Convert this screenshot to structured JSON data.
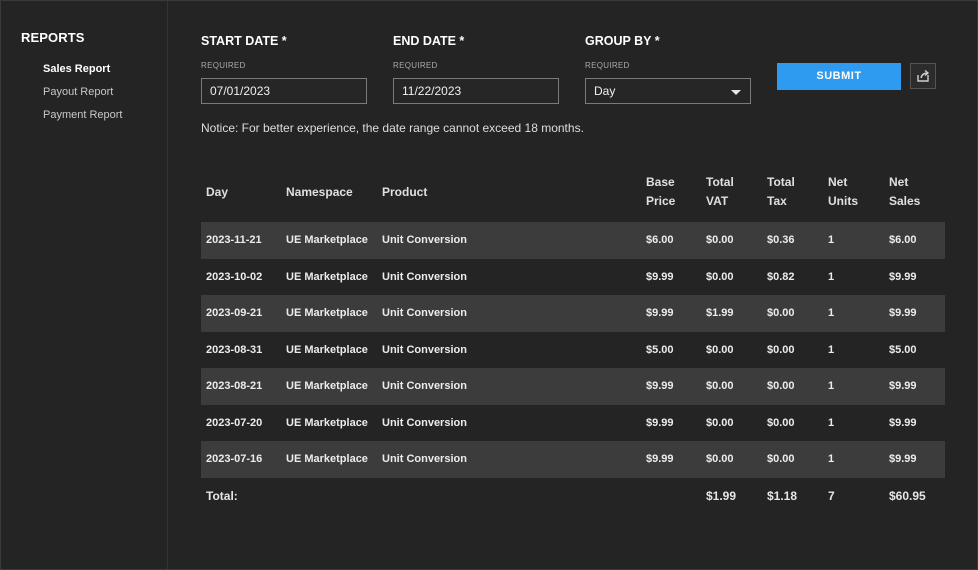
{
  "sidebar": {
    "title": "REPORTS",
    "items": [
      {
        "label": "Sales Report",
        "active": true
      },
      {
        "label": "Payout Report",
        "active": false
      },
      {
        "label": "Payment Report",
        "active": false
      }
    ]
  },
  "filters": {
    "start_date": {
      "label": "START DATE *",
      "sub": "REQUIRED",
      "value": "07/01/2023"
    },
    "end_date": {
      "label": "END DATE *",
      "sub": "REQUIRED",
      "value": "11/22/2023"
    },
    "group_by": {
      "label": "GROUP BY *",
      "sub": "REQUIRED",
      "value": "Day"
    },
    "submit_label": "SUBMIT",
    "export_icon": "share-export-icon"
  },
  "notice": "Notice: For better experience, the date range cannot exceed 18 months.",
  "table": {
    "headers": {
      "day": "Day",
      "namespace": "Namespace",
      "product": "Product",
      "base_price_1": "Base",
      "base_price_2": "Price",
      "total_vat_1": "Total",
      "total_vat_2": "VAT",
      "total_tax_1": "Total",
      "total_tax_2": "Tax",
      "net_units_1": "Net",
      "net_units_2": "Units",
      "net_sales_1": "Net",
      "net_sales_2": "Sales"
    },
    "rows": [
      {
        "day": "2023-11-21",
        "namespace": "UE Marketplace",
        "product": "Unit Conversion",
        "base_price": "$6.00",
        "total_vat": "$0.00",
        "total_tax": "$0.36",
        "net_units": "1",
        "net_sales": "$6.00"
      },
      {
        "day": "2023-10-02",
        "namespace": "UE Marketplace",
        "product": "Unit Conversion",
        "base_price": "$9.99",
        "total_vat": "$0.00",
        "total_tax": "$0.82",
        "net_units": "1",
        "net_sales": "$9.99"
      },
      {
        "day": "2023-09-21",
        "namespace": "UE Marketplace",
        "product": "Unit Conversion",
        "base_price": "$9.99",
        "total_vat": "$1.99",
        "total_tax": "$0.00",
        "net_units": "1",
        "net_sales": "$9.99"
      },
      {
        "day": "2023-08-31",
        "namespace": "UE Marketplace",
        "product": "Unit Conversion",
        "base_price": "$5.00",
        "total_vat": "$0.00",
        "total_tax": "$0.00",
        "net_units": "1",
        "net_sales": "$5.00"
      },
      {
        "day": "2023-08-21",
        "namespace": "UE Marketplace",
        "product": "Unit Conversion",
        "base_price": "$9.99",
        "total_vat": "$0.00",
        "total_tax": "$0.00",
        "net_units": "1",
        "net_sales": "$9.99"
      },
      {
        "day": "2023-07-20",
        "namespace": "UE Marketplace",
        "product": "Unit Conversion",
        "base_price": "$9.99",
        "total_vat": "$0.00",
        "total_tax": "$0.00",
        "net_units": "1",
        "net_sales": "$9.99"
      },
      {
        "day": "2023-07-16",
        "namespace": "UE Marketplace",
        "product": "Unit Conversion",
        "base_price": "$9.99",
        "total_vat": "$0.00",
        "total_tax": "$0.00",
        "net_units": "1",
        "net_sales": "$9.99"
      }
    ],
    "totals": {
      "label": "Total:",
      "total_vat": "$1.99",
      "total_tax": "$1.18",
      "net_units": "7",
      "net_sales": "$60.95"
    }
  },
  "colors": {
    "background": "#242424",
    "accent": "#2f9bf0",
    "row_alt": "#3c3c3c"
  }
}
